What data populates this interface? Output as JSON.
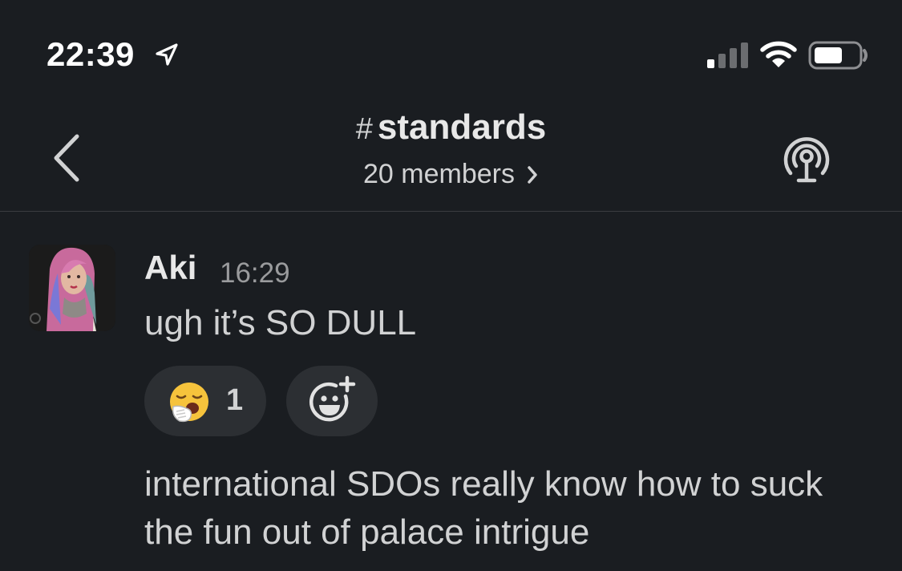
{
  "status_bar": {
    "time": "22:39"
  },
  "header": {
    "hash": "#",
    "channel_name": "standards",
    "members": "20 members"
  },
  "message": {
    "sender": "Aki",
    "timestamp": "16:29",
    "text_1": "ugh it’s SO DULL",
    "reactions": [
      {
        "emoji": "yawning-face",
        "count": "1"
      }
    ],
    "text_2": "international SDOs really know how to suck the fun out of palace intrigue"
  },
  "colors": {
    "background": "#1a1d21",
    "text": "#d1d2d3",
    "muted": "#9a9b9d",
    "pill": "#2c2f33"
  }
}
